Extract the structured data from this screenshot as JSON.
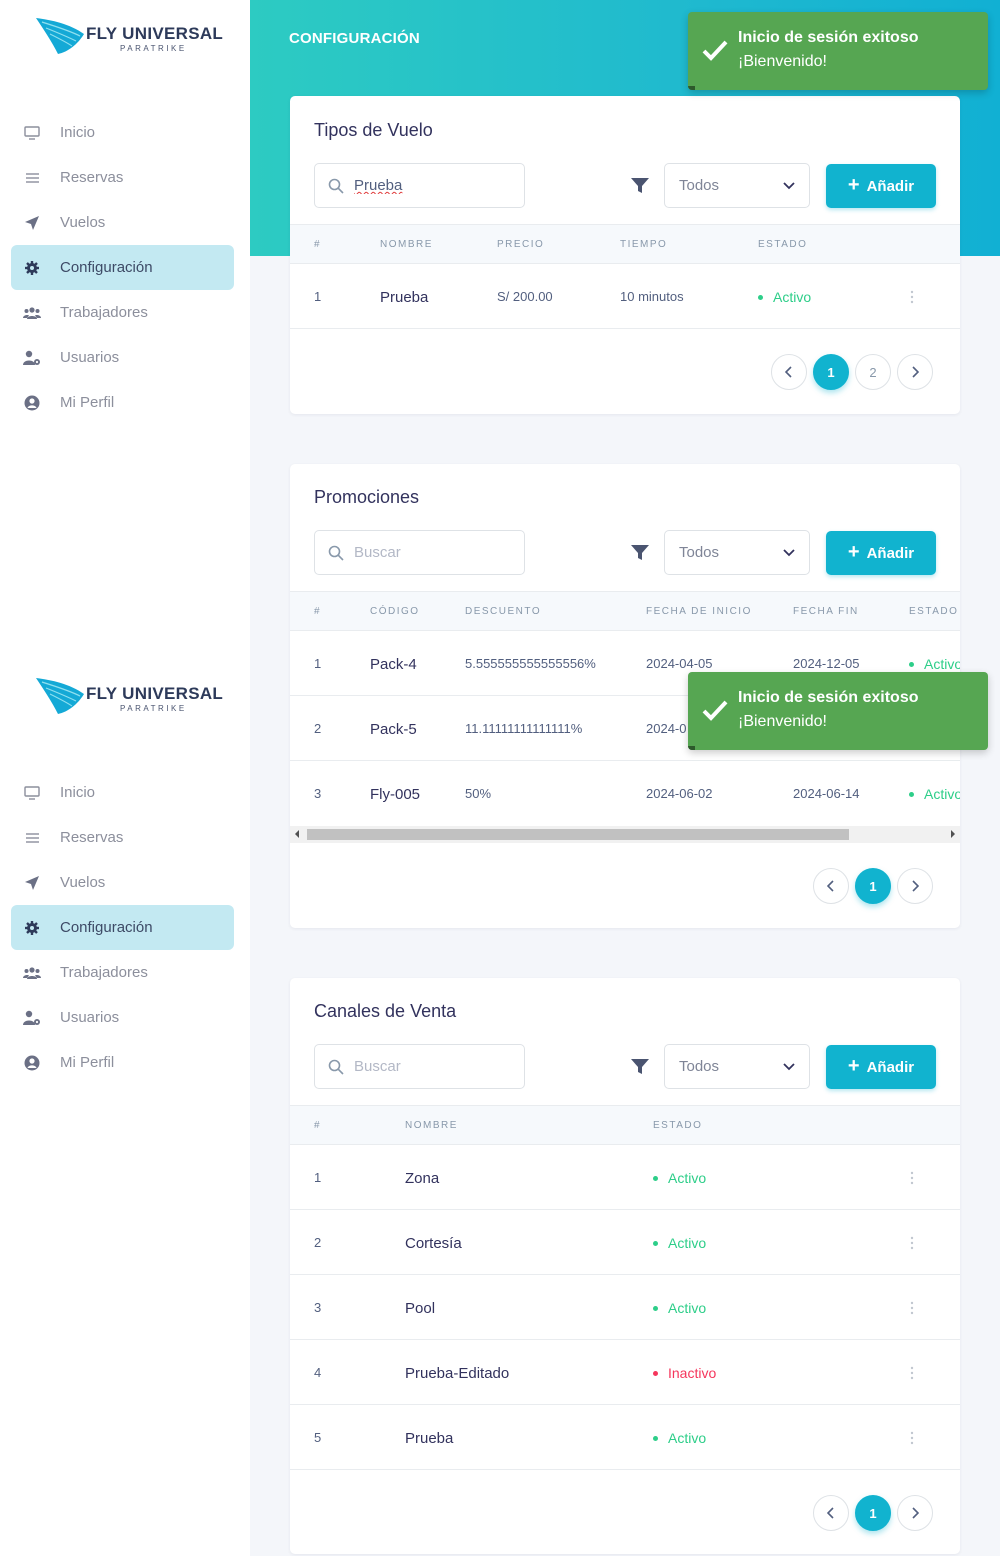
{
  "brand": {
    "name": "FLY UNIVERSAL",
    "tagline": "PARATRIKE"
  },
  "sidebar": {
    "items": [
      {
        "label": "Inicio",
        "icon": "monitor-icon"
      },
      {
        "label": "Reservas",
        "icon": "list-icon"
      },
      {
        "label": "Vuelos",
        "icon": "paper-plane-icon"
      },
      {
        "label": "Configuración",
        "icon": "gear-icon",
        "active": true
      },
      {
        "label": "Trabajadores",
        "icon": "users-icon"
      },
      {
        "label": "Usuarios",
        "icon": "user-gear-icon"
      },
      {
        "label": "Mi Perfil",
        "icon": "user-circle-icon"
      }
    ]
  },
  "header": {
    "title": "CONFIGURACIÓN"
  },
  "toast": {
    "title": "Inicio de sesión exitoso",
    "message": "¡Bienvenido!"
  },
  "tipos": {
    "title": "Tipos de Vuelo",
    "search_value": "Prueba",
    "search_placeholder": "Buscar",
    "filter_value": "Todos",
    "add_label": "Añadir",
    "columns": [
      "#",
      "NOMBRE",
      "PRECIO",
      "TIEMPO",
      "ESTADO"
    ],
    "rows": [
      {
        "idx": "1",
        "nombre": "Prueba",
        "precio": "S/ 200.00",
        "tiempo": "10 minutos",
        "estado": "Activo"
      }
    ],
    "pages": [
      "1",
      "2"
    ],
    "current_page": "1"
  },
  "promos": {
    "title": "Promociones",
    "search_placeholder": "Buscar",
    "filter_value": "Todos",
    "add_label": "Añadir",
    "columns": [
      "#",
      "CÓDIGO",
      "DESCUENTO",
      "FECHA DE INICIO",
      "FECHA FIN",
      "ESTADO"
    ],
    "rows": [
      {
        "idx": "1",
        "codigo": "Pack-4",
        "descuento": "5.555555555555556%",
        "inicio": "2024-04-05",
        "fin": "2024-12-05",
        "estado": "Activo"
      },
      {
        "idx": "2",
        "codigo": "Pack-5",
        "descuento": "11.11111111111111%",
        "inicio": "2024-0",
        "fin": "",
        "estado": ""
      },
      {
        "idx": "3",
        "codigo": "Fly-005",
        "descuento": "50%",
        "inicio": "2024-06-02",
        "fin": "2024-06-14",
        "estado": "Activo"
      }
    ],
    "pages": [
      "1"
    ],
    "current_page": "1"
  },
  "canales": {
    "title": "Canales de Venta",
    "search_placeholder": "Buscar",
    "filter_value": "Todos",
    "add_label": "Añadir",
    "columns": [
      "#",
      "NOMBRE",
      "ESTADO"
    ],
    "rows": [
      {
        "idx": "1",
        "nombre": "Zona",
        "estado": "Activo"
      },
      {
        "idx": "2",
        "nombre": "Cortesía",
        "estado": "Activo"
      },
      {
        "idx": "3",
        "nombre": "Pool",
        "estado": "Activo"
      },
      {
        "idx": "4",
        "nombre": "Prueba-Editado",
        "estado": "Inactivo"
      },
      {
        "idx": "5",
        "nombre": "Prueba",
        "estado": "Activo"
      }
    ],
    "pages": [
      "1"
    ],
    "current_page": "1"
  },
  "colors": {
    "accent": "#11b3cf",
    "active": "#2dce89",
    "inactive": "#f5365c",
    "toast": "#56a652"
  }
}
